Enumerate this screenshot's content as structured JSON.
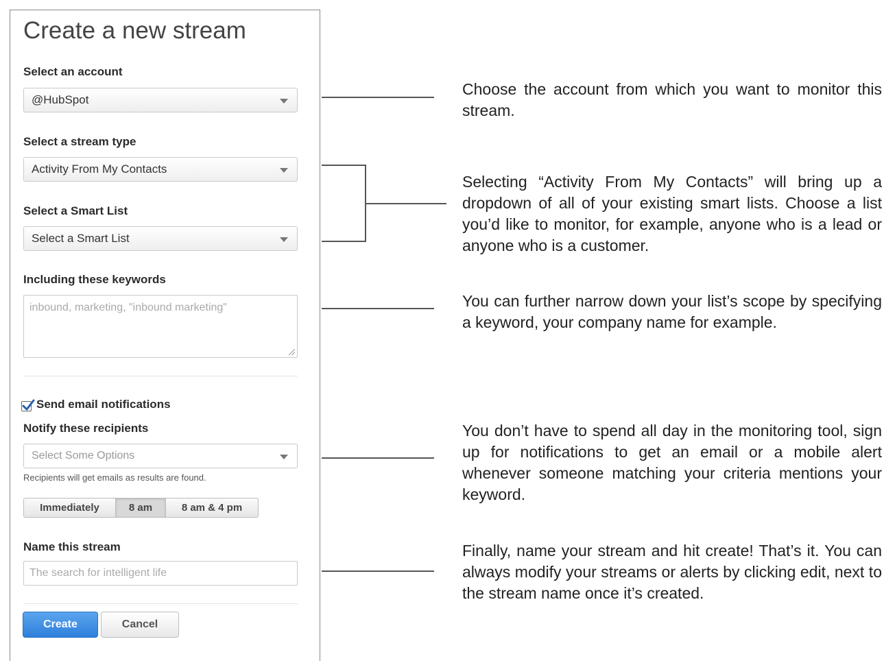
{
  "form": {
    "title": "Create a new stream",
    "account": {
      "label": "Select an account",
      "value": "@HubSpot"
    },
    "stream_type": {
      "label": "Select a stream type",
      "value": "Activity From My Contacts"
    },
    "smart_list": {
      "label": "Select a Smart List",
      "value": "Select a Smart List"
    },
    "keywords": {
      "label": "Including these keywords",
      "placeholder": "inbound, marketing, \"inbound marketing\""
    },
    "notifications": {
      "checkbox_label": "Send email notifications",
      "checked": true,
      "recipients_label": "Notify these recipients",
      "recipients_placeholder": "Select Some Options",
      "help_text": "Recipients will get emails as results are found.",
      "frequency_options": [
        "Immediately",
        "8 am",
        "8 am & 4 pm"
      ],
      "selected_frequency": "8 am"
    },
    "name": {
      "label": "Name this stream",
      "placeholder": "The search for intelligent life"
    },
    "buttons": {
      "create": "Create",
      "cancel": "Cancel"
    }
  },
  "annotations": [
    "Choose the account from which you want to monitor this stream.",
    "Selecting “Activity From My Contacts” will bring up a dropdown of all of your existing smart lists. Choose a list you’d like to monitor, for example, anyone who is a lead or anyone who is a customer.",
    "You can further narrow down your list’s scope by specifying a keyword, your company name for example.",
    "You don’t have to spend all day in the monitoring tool, sign up for notifications to get an email or a mobile alert whenever someone matching your criteria mentions your keyword.",
    "Finally, name your stream and hit create! That’s it. You can always modify your streams or alerts by clicking edit, next to the stream name once it’s created."
  ],
  "colors": {
    "primary_button": "#2f7fdc",
    "checkbox_check": "#2a5fb0"
  }
}
